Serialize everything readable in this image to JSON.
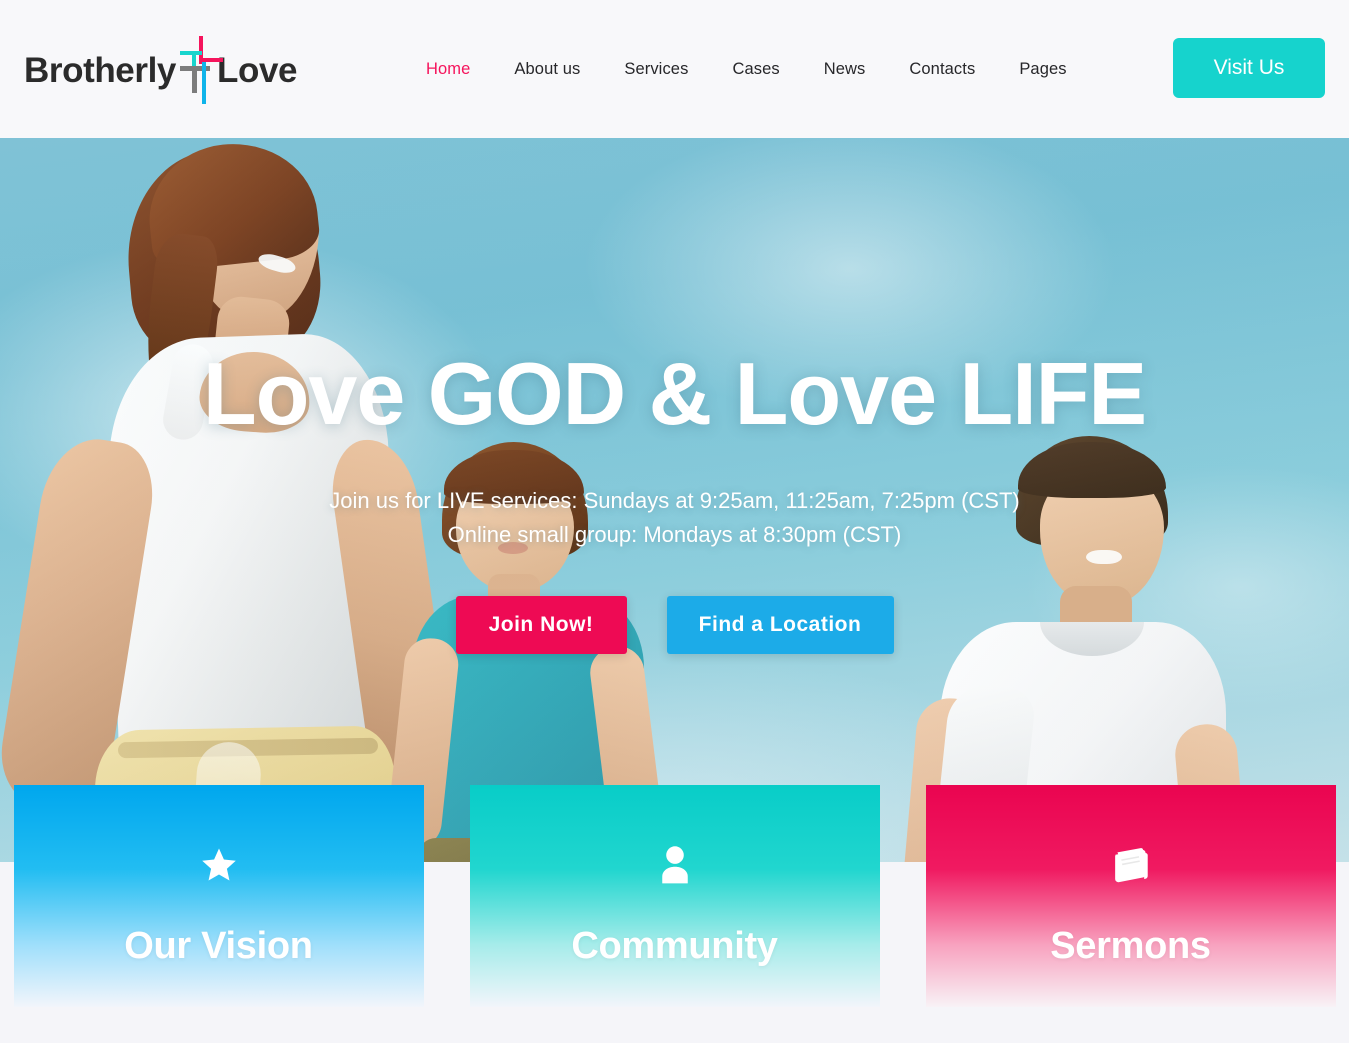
{
  "header": {
    "logo": {
      "word_left": "Brotherly",
      "word_right": "Love",
      "icon": "cross-icon",
      "colors": {
        "pink": "#f5145c",
        "teal": "#17d4cd",
        "gray": "#7c7c7c",
        "blue": "#0fb4ea",
        "text": "#2b2b2b"
      }
    },
    "nav": [
      {
        "label": "Home",
        "active": true
      },
      {
        "label": "About us",
        "active": false
      },
      {
        "label": "Services",
        "active": false
      },
      {
        "label": "Cases",
        "active": false
      },
      {
        "label": "News",
        "active": false
      },
      {
        "label": "Contacts",
        "active": false
      },
      {
        "label": "Pages",
        "active": false
      }
    ],
    "cta": {
      "label": "Visit Us",
      "color": "#16d3cd"
    },
    "background": "#f8f8fa",
    "active_color": "#f5145c"
  },
  "hero": {
    "title": "Love GOD & Love LIFE",
    "subtitle_line1": "Join us for LIVE services: Sundays at 9:25am, 11:25am, 7:25pm (CST)",
    "subtitle_line2": "Online small group: Mondays at 8:30pm (CST)",
    "buttons": [
      {
        "label": "Join Now!",
        "color": "#ee0a54"
      },
      {
        "label": "Find a Location",
        "color": "#1cabe8"
      }
    ],
    "image_description": "Family of four walking outdoors against a blue sky"
  },
  "cards": [
    {
      "title": "Our Vision",
      "icon": "star-icon",
      "color": "#00a7ee"
    },
    {
      "title": "Community",
      "icon": "person-icon",
      "color": "#08cdc8"
    },
    {
      "title": "Sermons",
      "icon": "book-icon",
      "color": "#ea0450"
    }
  ],
  "page": {
    "background": "#f5f5f9"
  }
}
